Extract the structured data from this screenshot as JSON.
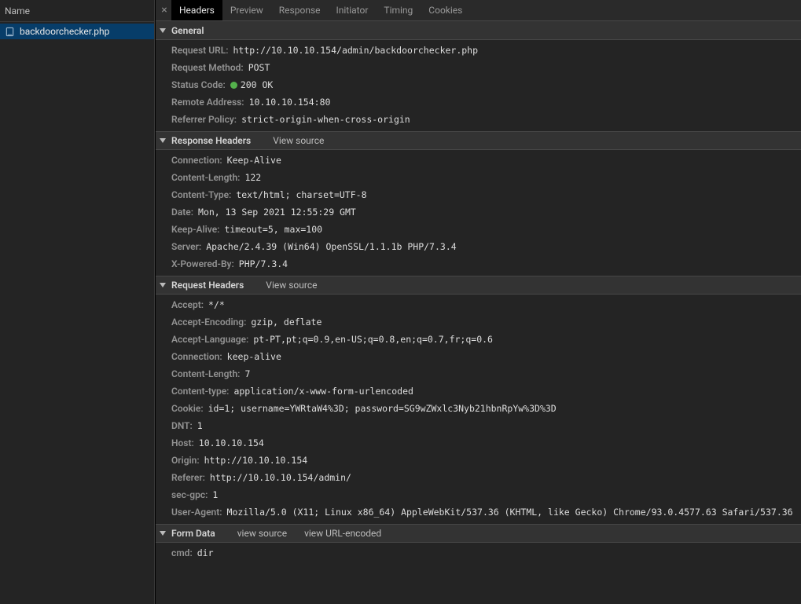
{
  "sidebar": {
    "header": "Name",
    "items": [
      {
        "label": "backdoorchecker.php",
        "selected": true
      }
    ]
  },
  "tabs": {
    "close_glyph": "×",
    "items": [
      {
        "label": "Headers",
        "active": true
      },
      {
        "label": "Preview"
      },
      {
        "label": "Response"
      },
      {
        "label": "Initiator"
      },
      {
        "label": "Timing"
      },
      {
        "label": "Cookies"
      }
    ]
  },
  "sections": {
    "general": {
      "title": "General",
      "rows": [
        {
          "k": "Request URL:",
          "v": "http://10.10.10.154/admin/backdoorchecker.php"
        },
        {
          "k": "Request Method:",
          "v": "POST"
        },
        {
          "k": "Status Code:",
          "v": "200 OK",
          "status_dot": true
        },
        {
          "k": "Remote Address:",
          "v": "10.10.10.154:80"
        },
        {
          "k": "Referrer Policy:",
          "v": "strict-origin-when-cross-origin"
        }
      ]
    },
    "response_headers": {
      "title": "Response Headers",
      "link": "View source",
      "rows": [
        {
          "k": "Connection:",
          "v": "Keep-Alive"
        },
        {
          "k": "Content-Length:",
          "v": "122"
        },
        {
          "k": "Content-Type:",
          "v": "text/html; charset=UTF-8"
        },
        {
          "k": "Date:",
          "v": "Mon, 13 Sep 2021 12:55:29 GMT"
        },
        {
          "k": "Keep-Alive:",
          "v": "timeout=5, max=100"
        },
        {
          "k": "Server:",
          "v": "Apache/2.4.39 (Win64) OpenSSL/1.1.1b PHP/7.3.4"
        },
        {
          "k": "X-Powered-By:",
          "v": "PHP/7.3.4"
        }
      ]
    },
    "request_headers": {
      "title": "Request Headers",
      "link": "View source",
      "rows": [
        {
          "k": "Accept:",
          "v": "*/*"
        },
        {
          "k": "Accept-Encoding:",
          "v": "gzip, deflate"
        },
        {
          "k": "Accept-Language:",
          "v": "pt-PT,pt;q=0.9,en-US;q=0.8,en;q=0.7,fr;q=0.6"
        },
        {
          "k": "Connection:",
          "v": "keep-alive"
        },
        {
          "k": "Content-Length:",
          "v": "7"
        },
        {
          "k": "Content-type:",
          "v": "application/x-www-form-urlencoded"
        },
        {
          "k": "Cookie:",
          "v": "id=1; username=YWRtaW4%3D; password=SG9wZWxlc3Nyb21hbnRpYw%3D%3D"
        },
        {
          "k": "DNT:",
          "v": "1"
        },
        {
          "k": "Host:",
          "v": "10.10.10.154"
        },
        {
          "k": "Origin:",
          "v": "http://10.10.10.154"
        },
        {
          "k": "Referer:",
          "v": "http://10.10.10.154/admin/"
        },
        {
          "k": "sec-gpc:",
          "v": "1"
        },
        {
          "k": "User-Agent:",
          "v": "Mozilla/5.0 (X11; Linux x86_64) AppleWebKit/537.36 (KHTML, like Gecko) Chrome/93.0.4577.63 Safari/537.36"
        }
      ]
    },
    "form_data": {
      "title": "Form Data",
      "link1": "view source",
      "link2": "view URL-encoded",
      "rows": [
        {
          "k": "cmd:",
          "v": "dir"
        }
      ]
    }
  }
}
